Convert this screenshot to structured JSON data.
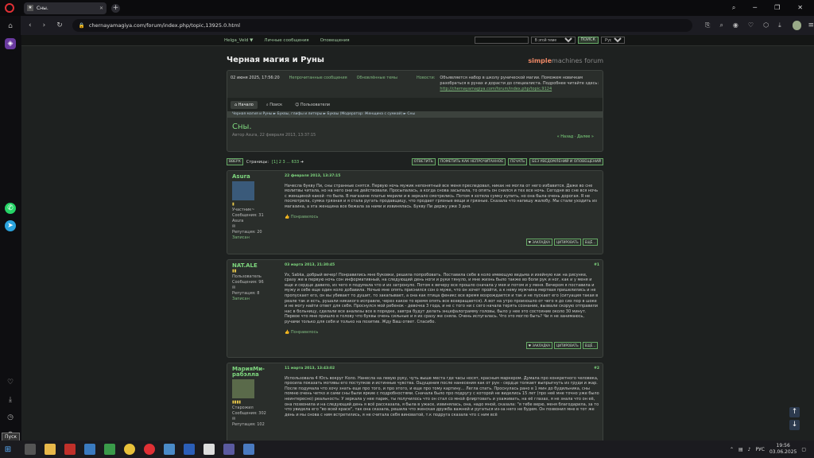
{
  "browser": {
    "tab_title": "Сны.",
    "tab_favicon": "★",
    "url": "chernayamagiya.com/forum/index.php/topic,13925.0.html"
  },
  "topbar": {
    "user": "Helga_Veld ▼",
    "pm": "Личные сообщения",
    "alerts": "Оповещения",
    "scope": "В этой теме",
    "search_btn": "ПОИСК",
    "lang": "Русский"
  },
  "site": {
    "title": "Черная магия и Руны",
    "brand": "simple",
    "brand2": "machines forum"
  },
  "info": {
    "date": "02 июня 2025, 17:56:20",
    "unread": "Непрочитанные сообщения",
    "updated": "Обновлённые темы",
    "news_label": "Новости:",
    "news": "Объявляется набор в школу рунической магии. Поможем новичкам разобраться в рунах и дорасти до специалиста. Подробнее читайте здесь:",
    "news_link": "http://chernayamagiya.com/forum/index.php/topic,9124"
  },
  "menu": {
    "home": "Начало",
    "search": "Поиск",
    "users": "Пользователи"
  },
  "crumbs": "Черная магия и Руны  ►  Буквы, глифы и литеры  ►  Буквы (Модератор: Женщина с сумкой)  ►  Сны",
  "topic": {
    "title": "Сны.",
    "author": "Автор Asura, 22 февраля 2013, 13:37:15",
    "nav": "« Назад · Далее »"
  },
  "pager": {
    "up": "ВВЕРХ",
    "label": "Страницы:",
    "pages": "[1] 2 3 ... 633",
    "next": "➜",
    "reply": "ОТВЕТИТЬ",
    "mark": "ПОМЕТИТЬ КАК НЕПРОЧИТАННОЕ",
    "print": "ПЕЧАТЬ",
    "notify": "БЕЗ УВЕДОМЛЕНИЙ И ОПОВЕЩЕНИЙ"
  },
  "posts": [
    {
      "name": "Asura",
      "stars": "▮",
      "role": "Участник~",
      "msgs": "Сообщения: 31",
      "sub": "Asura",
      "rep": "Репутация: 20",
      "saved": "Записан",
      "date": "22 февраля 2013, 13:37:15",
      "num": "",
      "text": "Начесла букву Пи, сны странные снятся. Первую ночь мужик непонятный все меня преследовал, никак не могла от него избавится. Даже во сне молитвы читала, но на него они не действовали. Просыпалась, а когда снова засыпала, то опять он снился и тех все ночь. Сегодня во сне вся ночь с женщиной какой -то была. В магазине платье мерили и в зеркало смотрелись. Потом я хотела сумку купить, но она была очень дорогая. Я не посмотрела, сумка грязная и я стала ругать продавщицу, что продает грязные вещи и грязные. Сказала что напишу жалобу. Мы стали уходить из магазина, а эта женщина все бежала за нами и извинялась. Букву Пи держу уже 3 дня.",
      "like": "Понравилось"
    },
    {
      "name": "NAT.ALE",
      "stars": "▮▮",
      "role": "Пользователь",
      "msgs": "Сообщения: 96",
      "sub": "",
      "rep": "Репутация: 8",
      "saved": "Записан",
      "date": "03 марта 2013, 21:30:45",
      "num": "#1",
      "text": "Ух, Sabka, добрый вечер! Понравились мне буковки, решила попробовать. Поставила себе в коло имеющую ведьма и изейную как на рисунке, сразу же в первую ночь сон информативный, на следующий день ноги и руки тянуло, и мне жизнь было также во боли рук и ног, как и у меня и еще и сердце давило, из чего я подумала что и их затронуло. Потом к вечеру все прошло сначала у мея и потом и у меня. Вечером я поставила и мужу и себе еще один коло добавила. Ночью мне опять приснился сон о муже, что он хочет пройти, а к нему мужчина мертвая пришелились и не пропускает его, он вы убивает то душит, то закапывает, а она как птица феникс все время возрождается и так и не пускает его (ситуация такая в реале так и есть, рушали никакого исправле, через какое то время опять все возвращается). А вот на утро произошло от чего я до сих пор в шоке и не могу найти ответ для себя. Проснулся мой ребенок - девочка 3 года, и не с того ни с сего начала терять сознание, вызвали скорую отправили нас в больницу, сделали все анализы все в порядке, завтра будут делать энцефалограмму головы, было у нее это состояние около 30 минут. Первое что мне пришло в голову что буквы очень сильные и я их сразу же сняла. Очень испугалась. Что это могло быть? Чи я не занимаюсь, ручами только для себя и только на позитив. Жду Ваш ответ. Спасибо.",
      "like": "Понравилось"
    },
    {
      "name": "МарияМи-рабэлла",
      "stars": "▮▮▮▮",
      "role": "Старожил",
      "msgs": "Сообщения: 302",
      "sub": "",
      "rep": "Репутация: 102",
      "saved": "",
      "date": "11 марта 2013, 13:43:02",
      "num": "#2",
      "text": "Использовала 4 Юсъ вокруг Коло. Нанесла на левую руку, чуть выше места где часы носят, красным маркером. Думала про конкретного человека, просила показать мотивы его поступков и истинные чувства. Ощущения после нанесения как от рун - сердце толкает выпрыгнуть из груди и жар. После подумала что хочу знать еще про того, и про этого, и еще про тому картину... Легла спать. Проснулась рано в 1 мин до будильника, сны помню очень четко и сами сны были яркие с подробностями. Сначала было про подругу с которой не виделись 15 лет (про неё мне точно уже было неинтересно) реальность: У зеркала у нее парик, ты получилось что он стал со мной флиртовать и ухаживать, на её глазах, я не знала что он её, она позвонила и на следующий день я всё рассказала, я была в ужасе, извинялась, она, надо мной, сказала: \"я тебе верю, меня благодарила, за то что увидела его \"во всей красе\", так она сказала, решила что женская дружба важней и ругаться из-за него не будем. Он позвонил мне в тот же день и мы снова с ним встретились, я не считала себя виноватой, т.к подруга сказала что с ним всё"
    }
  ],
  "pacts": {
    "bookmark": "♥ ЗАКЛАДКА",
    "quote": "ЦИТИРОВАТЬ",
    "more": "ЕЩЁ..."
  },
  "taskbar": {
    "lang": "РУС",
    "time": "19:56",
    "date": "03.06.2025",
    "pusk": "Пуск"
  }
}
